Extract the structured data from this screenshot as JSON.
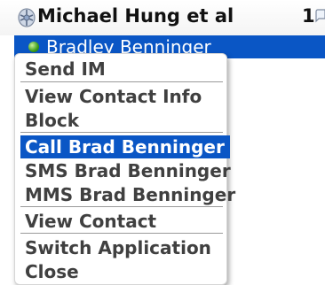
{
  "header": {
    "title": "Michael Hung et al",
    "count": "1"
  },
  "contact": {
    "name": "Bradley Benninger",
    "status": "available"
  },
  "menu": {
    "items": [
      {
        "label": "Send IM"
      },
      {
        "label": "View Contact Info"
      },
      {
        "label": "Block"
      },
      {
        "label": "Call Brad Benninger",
        "selected": true
      },
      {
        "label": "SMS Brad Benninger"
      },
      {
        "label": "MMS Brad Benninger"
      },
      {
        "label": "View Contact"
      },
      {
        "label": "Switch Application"
      },
      {
        "label": "Close"
      }
    ]
  },
  "colors": {
    "highlight": "#0a56c5",
    "menu_text": "#404040",
    "presence": "#3b9d17"
  }
}
